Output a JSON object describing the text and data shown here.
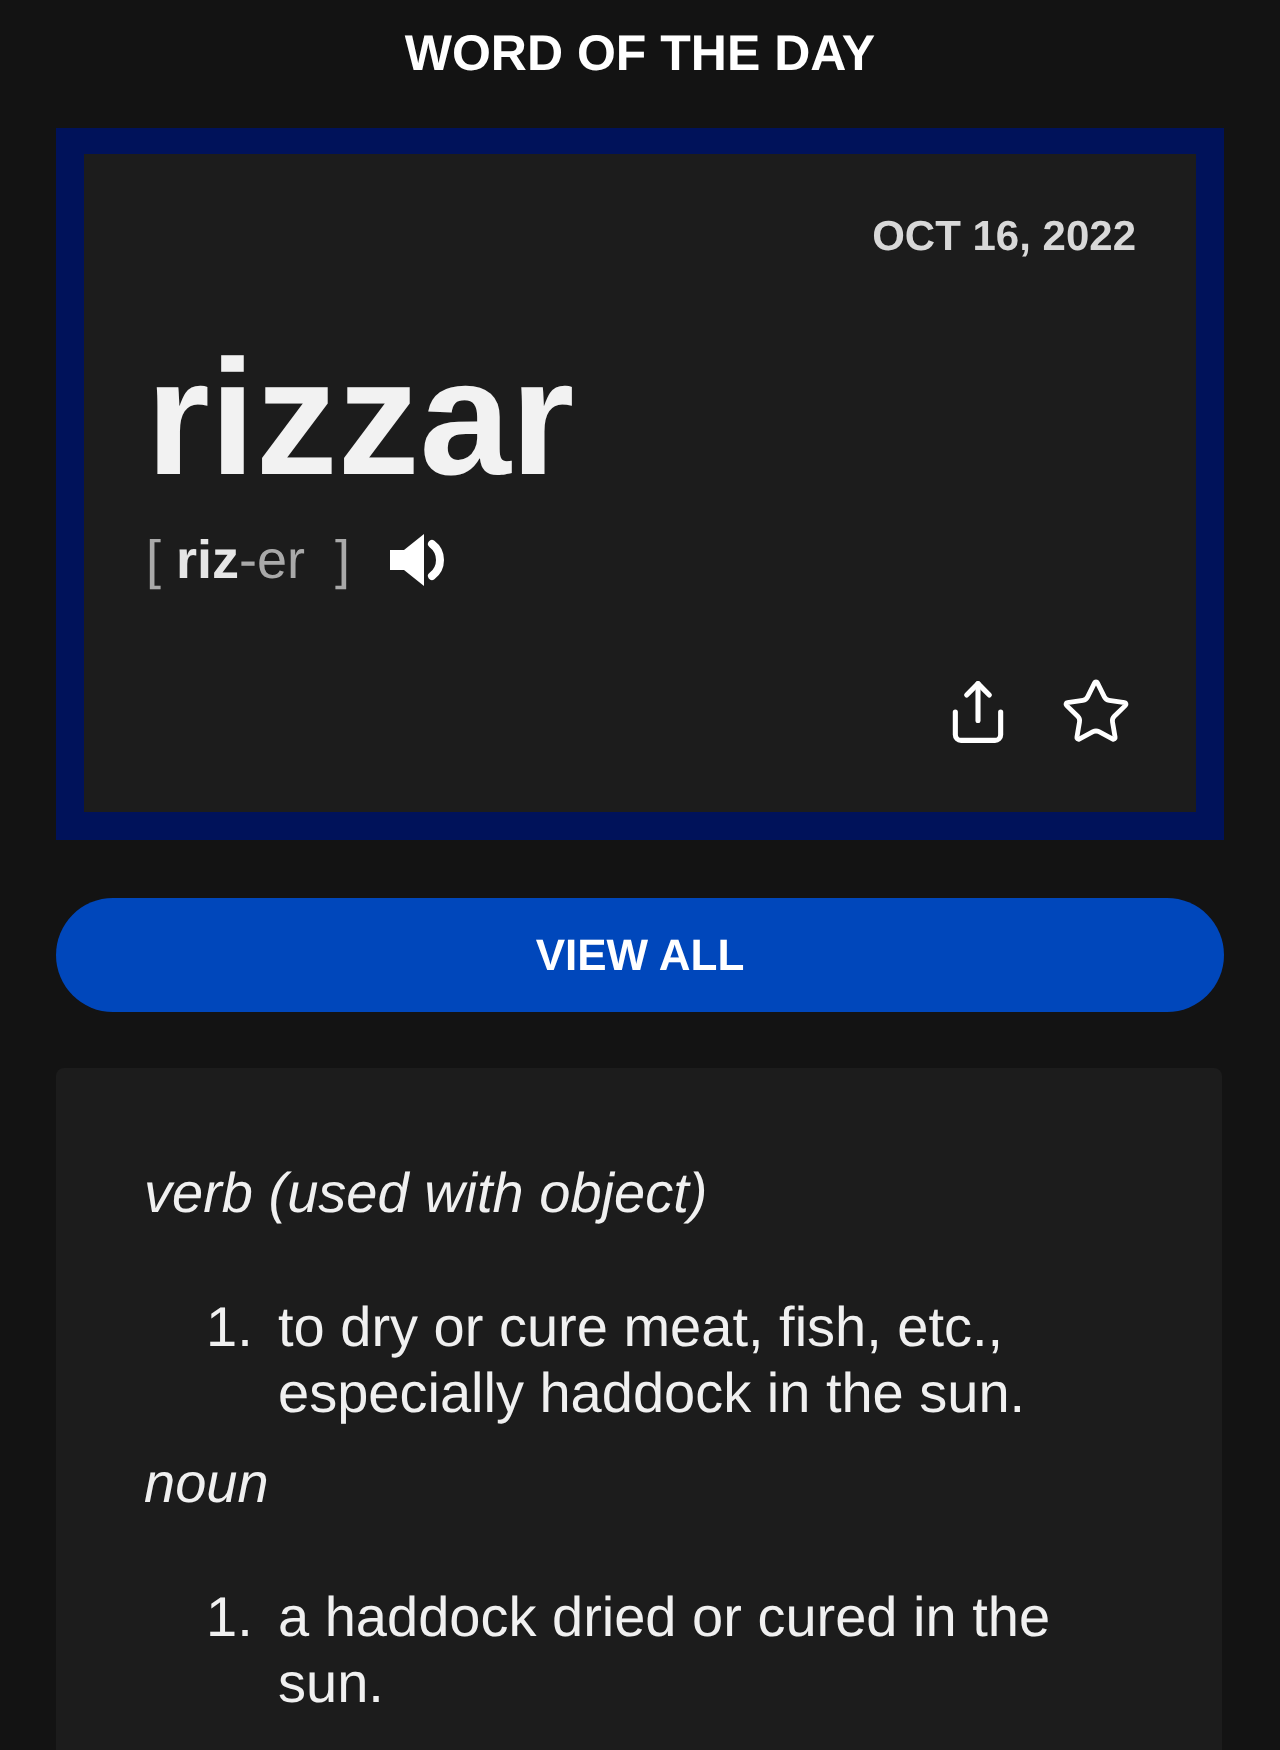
{
  "header": {
    "title": "WORD OF THE DAY"
  },
  "word_card": {
    "date": "OCT 16, 2022",
    "word": "rizzar",
    "pronunciation": "[ **riz**-er  ]",
    "favorited": false
  },
  "view_all_button": {
    "label": "VIEW ALL"
  },
  "definitions": [
    {
      "part_of_speech": "verb (used with object)",
      "senses": [
        {
          "number": "1.",
          "text": "to dry or cure meat, fish, etc., especially haddock in the sun."
        }
      ]
    },
    {
      "part_of_speech": "noun",
      "senses": [
        {
          "number": "1.",
          "text": "a haddock dried or cured in the sun."
        }
      ]
    }
  ]
}
